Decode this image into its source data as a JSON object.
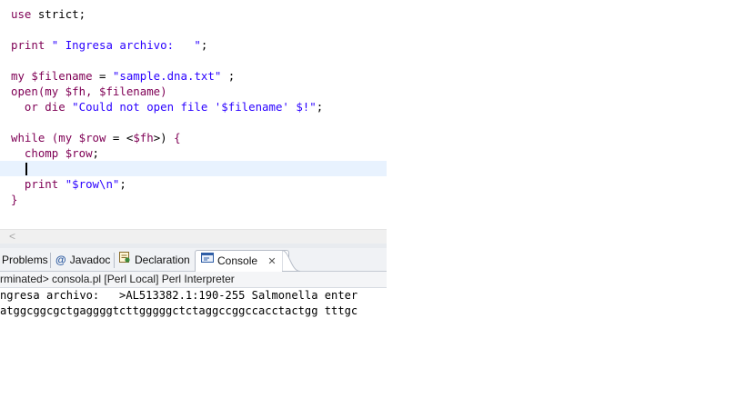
{
  "editor": {
    "lines": [
      {
        "t": [
          {
            "k": "kw",
            "v": "use"
          },
          {
            "k": "",
            "v": " strict;"
          }
        ]
      },
      {
        "t": []
      },
      {
        "t": [
          {
            "k": "kw",
            "v": "print"
          },
          {
            "k": "",
            "v": " "
          },
          {
            "k": "str",
            "v": "\" Ingresa archivo:   \""
          },
          {
            "k": "",
            "v": ";"
          }
        ]
      },
      {
        "t": []
      },
      {
        "t": [
          {
            "k": "kw",
            "v": "my"
          },
          {
            "k": "",
            "v": " "
          },
          {
            "k": "var",
            "v": "$filename"
          },
          {
            "k": "",
            "v": " = "
          },
          {
            "k": "str",
            "v": "\"sample.dna.txt\""
          },
          {
            "k": "",
            "v": " ;"
          }
        ]
      },
      {
        "t": [
          {
            "k": "kw",
            "v": "open"
          },
          {
            "k": "var",
            "v": "(my $fh, $filename)"
          }
        ]
      },
      {
        "t": [
          {
            "k": "",
            "v": "  "
          },
          {
            "k": "kw",
            "v": "or die"
          },
          {
            "k": "",
            "v": " "
          },
          {
            "k": "str",
            "v": "\"Could not open file '$filename' $!\""
          },
          {
            "k": "",
            "v": ";"
          }
        ]
      },
      {
        "t": []
      },
      {
        "t": [
          {
            "k": "kw",
            "v": "while"
          },
          {
            "k": "",
            "v": " "
          },
          {
            "k": "var",
            "v": "(my $row"
          },
          {
            "k": "",
            "v": " = <"
          },
          {
            "k": "var",
            "v": "$fh"
          },
          {
            "k": "",
            "v": ">) "
          },
          {
            "k": "kw",
            "v": "{"
          }
        ]
      },
      {
        "t": [
          {
            "k": "",
            "v": "  "
          },
          {
            "k": "kw",
            "v": "chomp"
          },
          {
            "k": "",
            "v": " "
          },
          {
            "k": "var",
            "v": "$row"
          },
          {
            "k": "",
            "v": ";"
          }
        ]
      },
      {
        "t": [],
        "current": true
      },
      {
        "t": [
          {
            "k": "",
            "v": "  "
          },
          {
            "k": "kw",
            "v": "print"
          },
          {
            "k": "",
            "v": " "
          },
          {
            "k": "str",
            "v": "\"$row\\n\""
          },
          {
            "k": "",
            "v": ";"
          }
        ]
      },
      {
        "t": [
          {
            "k": "kw",
            "v": "}"
          }
        ]
      }
    ]
  },
  "scrollbar": {
    "left_arrow": "<"
  },
  "views": {
    "tabs": [
      {
        "id": "problems",
        "label": "Problems",
        "icon": "problems-icon"
      },
      {
        "id": "javadoc",
        "label": "Javadoc",
        "icon": "at-icon",
        "glyph": "@"
      },
      {
        "id": "declaration",
        "label": "Declaration",
        "icon": "declaration-icon"
      },
      {
        "id": "console",
        "label": "Console",
        "icon": "console-icon",
        "active": true
      }
    ],
    "close_glyph": "✕"
  },
  "console": {
    "header": "rminated> consola.pl [Perl Local] Perl Interpreter",
    "output": [
      "ngresa archivo:   >AL513382.1:190-255 Salmonella enter",
      "atggcggcgctgaggggtcttgggggctctaggccggccacctactgg tttgc"
    ]
  },
  "colors": {
    "keyword": "#7f0055",
    "string": "#2a00ff",
    "current_line": "#e8f2fe",
    "tabbar_bg": "#f0f2f5"
  }
}
